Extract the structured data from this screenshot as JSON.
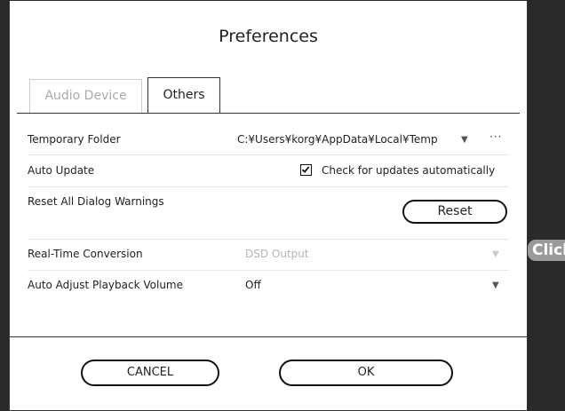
{
  "dialog": {
    "title": "Preferences"
  },
  "tabs": [
    {
      "label": "Audio Device",
      "active": false
    },
    {
      "label": "Others",
      "active": true
    }
  ],
  "rows": {
    "temporary_folder": {
      "label": "Temporary Folder",
      "value": "C:¥Users¥korg¥AppData¥Local¥Temp",
      "dropdown_icon": "triangle-down-icon",
      "browse_label": "···"
    },
    "auto_update": {
      "label": "Auto Update",
      "checkbox_checked": true,
      "checkbox_label": "Check for updates automatically"
    },
    "reset_warnings": {
      "label": "Reset All Dialog Warnings",
      "button_label": "Reset"
    },
    "real_time_conversion": {
      "label": "Real-Time Conversion",
      "value": "DSD Output",
      "disabled": true
    },
    "auto_adjust_volume": {
      "label": "Auto Adjust Playback Volume",
      "value": "Off"
    }
  },
  "footer": {
    "cancel_label": "CANCEL",
    "ok_label": "OK"
  },
  "overlay": {
    "badge_text": "Click"
  },
  "colors": {
    "border": "#333333",
    "disabled_text": "#b5b5b5",
    "badge_bg": "#9a9a9a"
  }
}
